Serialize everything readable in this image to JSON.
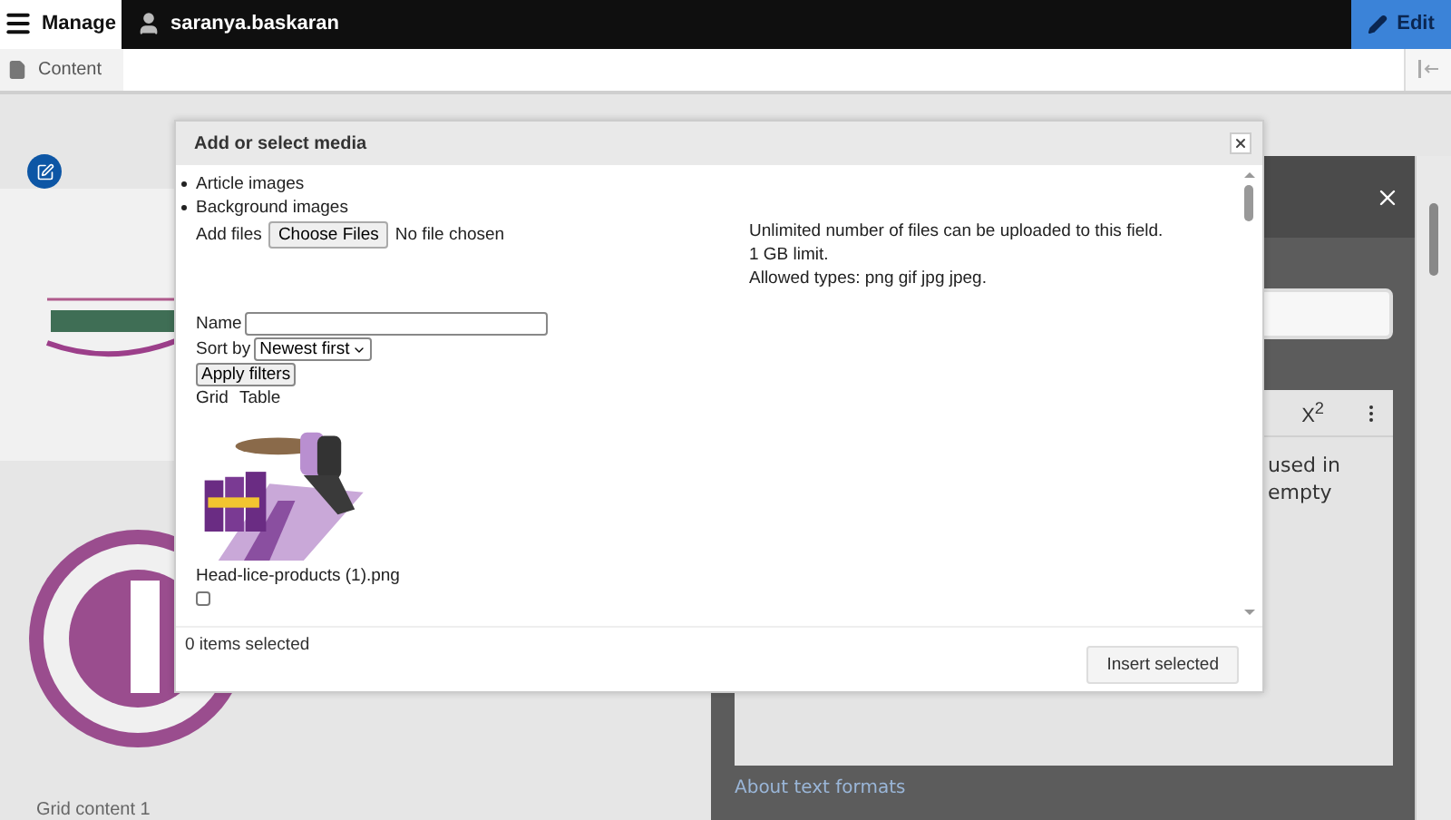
{
  "toolbar": {
    "manage": "Manage",
    "user": "saranya.baskaran",
    "edit": "Edit"
  },
  "tray": {
    "tabs": [
      {
        "label": "Content",
        "selected": true
      }
    ]
  },
  "content": {
    "grid_label": "Grid content 1"
  },
  "side_dialog": {
    "superscript_button": "X$^{2}$",
    "editor_lines": [
      "used in",
      "empty"
    ],
    "link": "About text formats"
  },
  "modal": {
    "title": "Add or select media",
    "media_types": [
      "Article images",
      "Background images"
    ],
    "add_files": {
      "label": "Add files",
      "button": "Choose Files",
      "status": "No file chosen"
    },
    "help": [
      "Unlimited number of files can be uploaded to this field.",
      "1 GB limit.",
      "Allowed types: png gif jpg jpeg."
    ],
    "filters": {
      "name_label": "Name",
      "sort_label": "Sort by",
      "sort_value": "Newest first",
      "apply": "Apply filters"
    },
    "views": [
      "Grid",
      "Table"
    ],
    "items": [
      {
        "kind": "picture",
        "filename": "Head-lice-products (1).png",
        "checked": false
      }
    ],
    "footer": {
      "count": "0 items selected",
      "insert": "Insert selected"
    }
  }
}
